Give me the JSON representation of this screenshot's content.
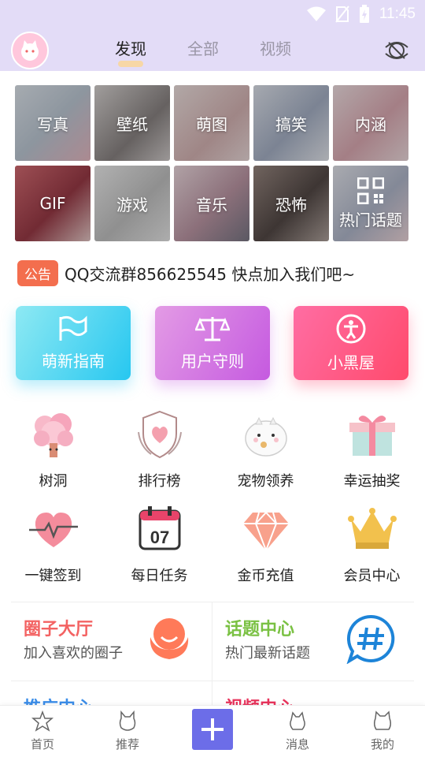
{
  "status_bar": {
    "time": "11:45"
  },
  "header": {
    "tabs": [
      {
        "label": "发现",
        "active": true
      },
      {
        "label": "全部",
        "active": false
      },
      {
        "label": "视频",
        "active": false
      }
    ]
  },
  "categories": [
    {
      "label": "写真",
      "color": "#c9d4e0"
    },
    {
      "label": "壁纸",
      "color": "#b8b2b4"
    },
    {
      "label": "萌图",
      "color": "#e3c9c9"
    },
    {
      "label": "搞笑",
      "color": "#b9c3d6"
    },
    {
      "label": "内涵",
      "color": "#e8c8cc"
    },
    {
      "label": "GIF",
      "color": "#b44a55"
    },
    {
      "label": "游戏",
      "color": "#d9d9d9"
    },
    {
      "label": "音乐",
      "color": "#d8b9c3"
    },
    {
      "label": "恐怖",
      "color": "#6f5a55"
    },
    {
      "label": "热门话题",
      "color": "#c4cad8",
      "icon": "qr-icon"
    }
  ],
  "notice": {
    "badge": "公告",
    "text": "QQ交流群856625545 快点加入我们吧~"
  },
  "actions": [
    {
      "label": "萌新指南",
      "icon": "flag-icon"
    },
    {
      "label": "用户守则",
      "icon": "scales-icon"
    },
    {
      "label": "小黑屋",
      "icon": "person-icon"
    }
  ],
  "features": [
    {
      "label": "树洞",
      "icon": "tree-icon"
    },
    {
      "label": "排行榜",
      "icon": "shield-heart-icon"
    },
    {
      "label": "宠物领养",
      "icon": "pet-icon"
    },
    {
      "label": "幸运抽奖",
      "icon": "gift-icon"
    },
    {
      "label": "一键签到",
      "icon": "heartbeat-icon"
    },
    {
      "label": "每日任务",
      "icon": "calendar-icon",
      "day": "07"
    },
    {
      "label": "金币充值",
      "icon": "diamond-icon"
    },
    {
      "label": "会员中心",
      "icon": "crown-icon"
    }
  ],
  "panels": [
    {
      "title": "圈子大厅",
      "subtitle": "加入喜欢的圈子",
      "color": "#f36262",
      "icon": "hug-icon"
    },
    {
      "title": "话题中心",
      "subtitle": "热门最新话题",
      "color": "#7ac143",
      "icon": "hashtag-icon"
    },
    {
      "title": "推广中心",
      "subtitle": "",
      "color": "#3b8de8",
      "icon": "promo-icon"
    },
    {
      "title": "视频中心",
      "subtitle": "",
      "color": "#e8345c",
      "icon": "video-icon"
    }
  ],
  "bottom_nav": [
    {
      "label": "首页",
      "icon": "home-icon"
    },
    {
      "label": "推荐",
      "icon": "recommend-icon"
    },
    {
      "label": "消息",
      "icon": "message-icon"
    },
    {
      "label": "我的",
      "icon": "profile-icon"
    }
  ]
}
